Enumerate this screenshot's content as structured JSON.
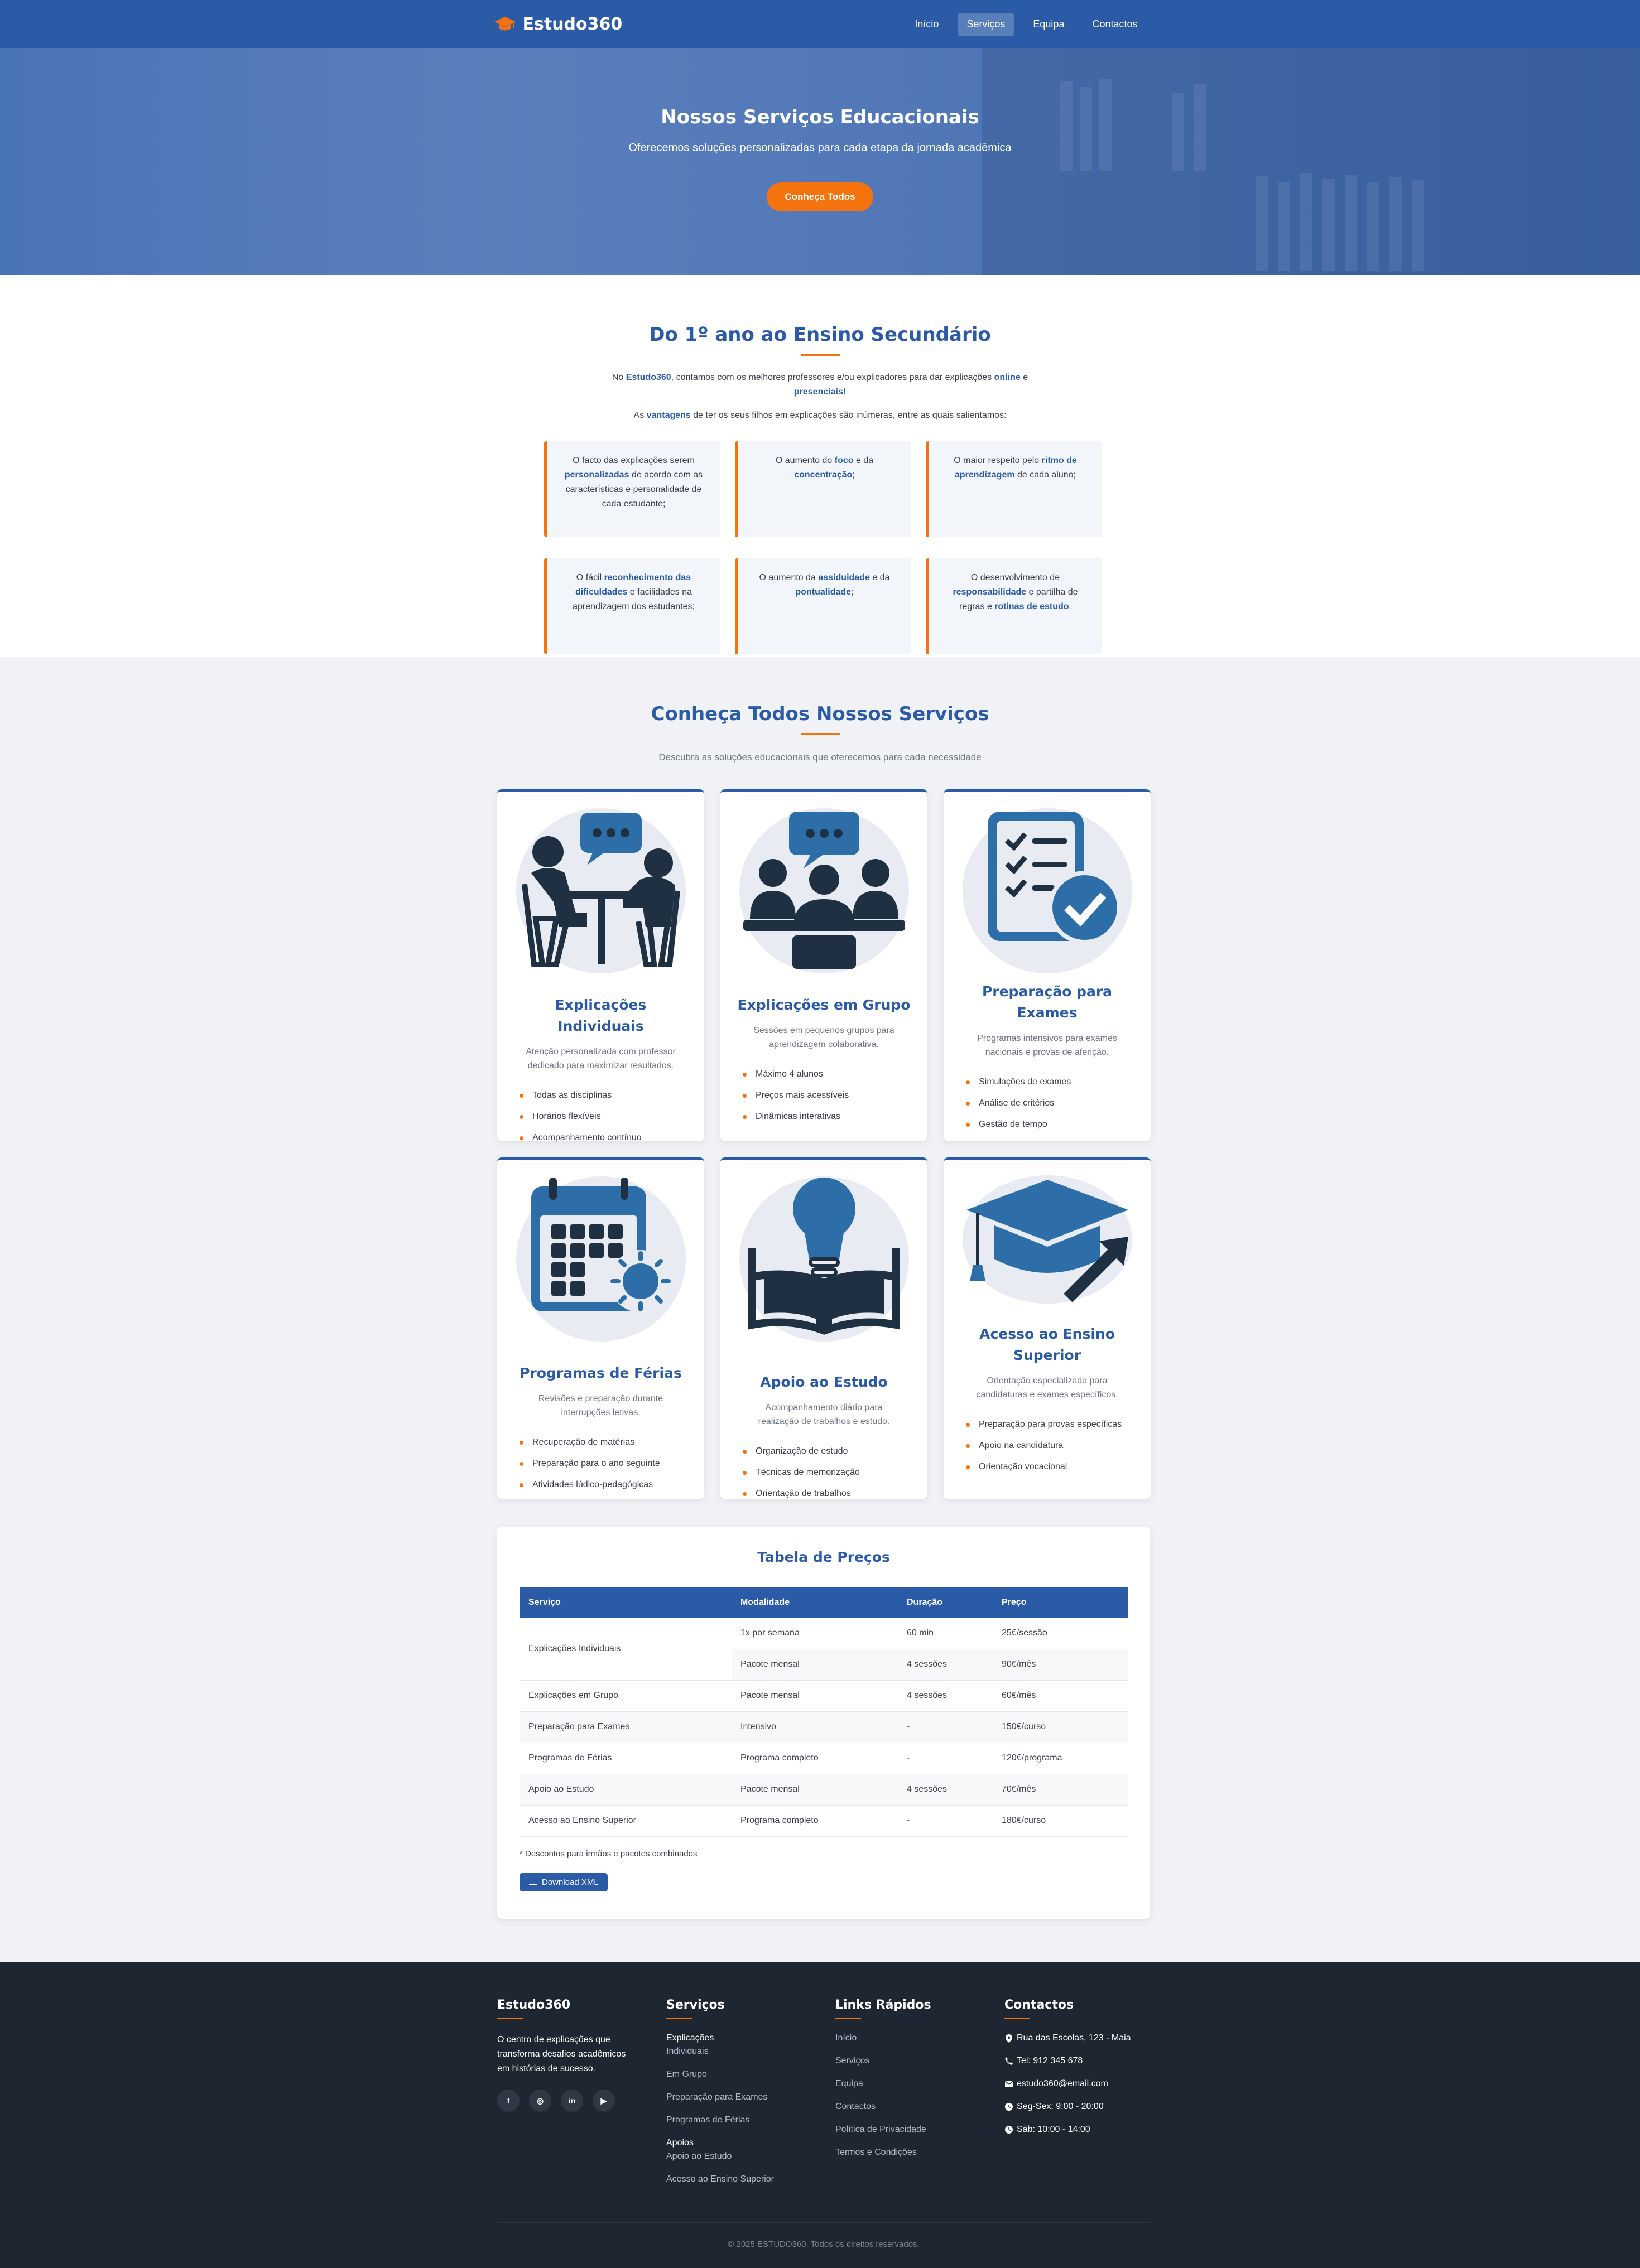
{
  "nav": {
    "logo": "Estudo360",
    "items": [
      {
        "label": "Início",
        "active": false
      },
      {
        "label": "Serviços",
        "active": true
      },
      {
        "label": "Equipa",
        "active": false
      },
      {
        "label": "Contactos",
        "active": false
      }
    ]
  },
  "hero": {
    "title": "Nossos Serviços Educacionais",
    "subtitle": "Oferecemos soluções personalizadas para cada etapa da jornada acadêmica",
    "cta": "Conheça Todos"
  },
  "intro": {
    "title": "Do 1º ano ao Ensino Secundário",
    "p1_pre": "No ",
    "p1_brand": "Estudo360",
    "p1_mid": ", contamos com os melhores professores e/ou explicadores para dar explicações ",
    "p1_online": "online",
    "p1_and": " e ",
    "p1_presenciais": "presenciais!",
    "p2_pre": "As ",
    "p2_hl": "vantagens",
    "p2_post": " de ter os seus filhos em explicações são inúmeras, entre as quais salientamos:",
    "advantages": [
      {
        "pre": "O facto das explicações serem ",
        "hl": "personalizadas",
        "post": " de acordo com as características e personalidade de cada estudante;"
      },
      {
        "pre": "O aumento do ",
        "hl": "foco",
        "mid": " e da ",
        "hl2": "concentração",
        "post": ";"
      },
      {
        "pre": "O maior respeito pelo ",
        "hl": "ritmo de aprendizagem",
        "post": " de cada aluno;"
      },
      {
        "pre": "O fácil ",
        "hl": "reconhecimento das dificuldades",
        "post": " e facilidades na aprendizagem dos estudantes;"
      },
      {
        "pre": "O aumento da ",
        "hl": "assiduidade",
        "mid": " e da ",
        "hl2": "pontualidade",
        "post": ";"
      },
      {
        "pre": "O desenvolvimento de ",
        "hl": "responsabilidade",
        "mid": " e partilha de regras e ",
        "hl2": "rotinas de estudo",
        "post": "."
      }
    ]
  },
  "services": {
    "title": "Conheça Todos Nossos Serviços",
    "subtitle": "Descubra as soluções educacionais que oferecemos para cada necessidade",
    "cards": [
      {
        "icon": "tutoring-icon",
        "title": "Explicações Individuais",
        "desc": "Atenção personalizada com professor dedicado para maximizar resultados.",
        "items": [
          "Todas as disciplinas",
          "Horários flexíveis",
          "Acompanhamento contínuo"
        ]
      },
      {
        "icon": "group-icon",
        "title": "Explicações em Grupo",
        "desc": "Sessões em pequenos grupos para aprendizagem colaborativa.",
        "items": [
          "Máximo 4 alunos",
          "Preços mais acessíveis",
          "Dinâmicas interativas"
        ]
      },
      {
        "icon": "checklist-icon",
        "title": "Preparação para Exames",
        "desc": "Programas intensivos para exames nacionais e provas de aferição.",
        "items": [
          "Simulações de exames",
          "Análise de critérios",
          "Gestão de tempo"
        ]
      },
      {
        "icon": "calendar-sun-icon",
        "title": "Programas de Férias",
        "desc": "Revisões e preparação durante interrupções letivas.",
        "items": [
          "Recuperação de matérias",
          "Preparação para o ano seguinte",
          "Atividades lúdico-pedagógicas"
        ]
      },
      {
        "icon": "bulb-book-icon",
        "title": "Apoio ao Estudo",
        "desc": "Acompanhamento diário para realização de trabalhos e estudo.",
        "items": [
          "Organização de estudo",
          "Técnicas de memorização",
          "Orientação de trabalhos"
        ]
      },
      {
        "icon": "graduation-cap-icon",
        "title": "Acesso ao Ensino Superior",
        "desc": "Orientação especializada para candidaturas e exames específicos.",
        "items": [
          "Preparação para provas específicas",
          "Apoio na candidatura",
          "Orientação vocacional"
        ]
      }
    ]
  },
  "prices": {
    "title": "Tabela de Preços",
    "headers": [
      "Serviço",
      "Modalidade",
      "Duração",
      "Preço"
    ],
    "rows": [
      [
        "Explicações Individuais",
        "1x por semana",
        "60 min",
        "25€/sessão"
      ],
      [
        "",
        "Pacote mensal",
        "4 sessões",
        "90€/mês"
      ],
      [
        "Explicações em Grupo",
        "Pacote mensal",
        "4 sessões",
        "60€/mês"
      ],
      [
        "Preparação para Exames",
        "Intensivo",
        "-",
        "150€/curso"
      ],
      [
        "Programas de Férias",
        "Programa completo",
        "-",
        "120€/programa"
      ],
      [
        "Apoio ao Estudo",
        "Pacote mensal",
        "4 sessões",
        "70€/mês"
      ],
      [
        "Acesso ao Ensino Superior",
        "Programa completo",
        "-",
        "180€/curso"
      ]
    ],
    "note": "* Descontos para irmãos e pacotes combinados",
    "download": "Download XML"
  },
  "footer": {
    "brand": "Estudo360",
    "about": "O centro de explicações que transforma desafios acadêmicos em histórias de sucesso.",
    "social": [
      "f",
      "◎",
      "in",
      "▶"
    ],
    "services_title": "Serviços",
    "services": [
      "Explicações",
      "Individuais",
      "Em Grupo",
      "Preparação para Exames",
      "Programas de Férias",
      "Apoios",
      "Apoio ao Estudo",
      "Acesso ao Ensino Superior"
    ],
    "links_title": "Links Rápidos",
    "links": [
      "Início",
      "Serviços",
      "Equipa",
      "Contactos",
      "Política de Privacidade",
      "Termos e Condições"
    ],
    "contacts_title": "Contactos",
    "contacts": [
      {
        "icon": "map-pin-icon",
        "text": "Rua das Escolas, 123 - Maia"
      },
      {
        "icon": "phone-icon",
        "text": "Tel: 912 345 678"
      },
      {
        "icon": "envelope-icon",
        "text": "estudo360@email.com"
      },
      {
        "icon": "clock-icon",
        "text": "Seg-Sex: 9:00 - 20:00"
      },
      {
        "icon": "clock-icon",
        "text": "Sáb: 10:00 - 14:00"
      }
    ],
    "copyright": "© 2025 ESTUDO360. Todos os direitos reservados."
  },
  "colors": {
    "brand_blue": "#2b5ba7",
    "accent_orange": "#f5730f",
    "footer_bg": "#1e2631",
    "icon_dark": "#1f3042",
    "icon_blue": "#2d6ea8"
  }
}
